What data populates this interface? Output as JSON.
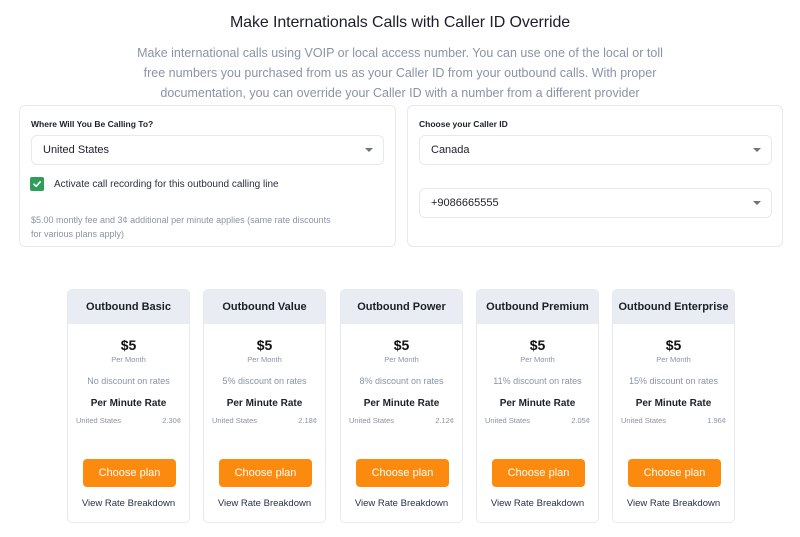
{
  "header": {
    "title": "Make Internationals Calls with Caller ID Override",
    "intro": "Make international calls using VOIP or local access number. You can use one of the local or toll free numbers you purchased from us as your Caller ID from your outbound calls. With proper documentation, you can override your Caller ID with a number from a different provider"
  },
  "destination": {
    "label": "Where Will You Be Calling To?",
    "selected": "United States",
    "recording_checked": true,
    "recording_label": "Activate call recording for this outbound calling line",
    "fee_note": "$5.00 montly fee and 3¢ additional per minute applies (same rate discounts for various plans apply)"
  },
  "caller_id": {
    "label": "Choose your Caller ID",
    "country_selected": "Canada",
    "number_selected": "+9086665555"
  },
  "colors": {
    "accent": "#fb8a0f",
    "checkbox": "#2f9e5b",
    "plan_header_bg": "#e9edf3"
  },
  "plans": [
    {
      "name": "Outbound Basic",
      "price": "$5",
      "period": "Per Month",
      "discount": "No discount on rates",
      "rate_title": "Per Minute Rate",
      "rate_country": "United States",
      "rate_value": "2.30¢",
      "button": "Choose plan",
      "link": "View Rate Breakdown"
    },
    {
      "name": "Outbound Value",
      "price": "$5",
      "period": "Per Month",
      "discount": "5% discount on rates",
      "rate_title": "Per Minute Rate",
      "rate_country": "United States",
      "rate_value": "2.18¢",
      "button": "Choose plan",
      "link": "View Rate Breakdown"
    },
    {
      "name": "Outbound Power",
      "price": "$5",
      "period": "Per Month",
      "discount": "8% discount on rates",
      "rate_title": "Per Minute Rate",
      "rate_country": "United States",
      "rate_value": "2.12¢",
      "button": "Choose plan",
      "link": "View Rate Breakdown"
    },
    {
      "name": "Outbound Premium",
      "price": "$5",
      "period": "Per Month",
      "discount": "11% discount on rates",
      "rate_title": "Per Minute Rate",
      "rate_country": "United States",
      "rate_value": "2.05¢",
      "button": "Choose plan",
      "link": "View Rate Breakdown"
    },
    {
      "name": "Outbound Enterprise",
      "price": "$5",
      "period": "Per Month",
      "discount": "15% discount on rates",
      "rate_title": "Per Minute Rate",
      "rate_country": "United States",
      "rate_value": "1.96¢",
      "button": "Choose plan",
      "link": "View Rate Breakdown"
    }
  ]
}
